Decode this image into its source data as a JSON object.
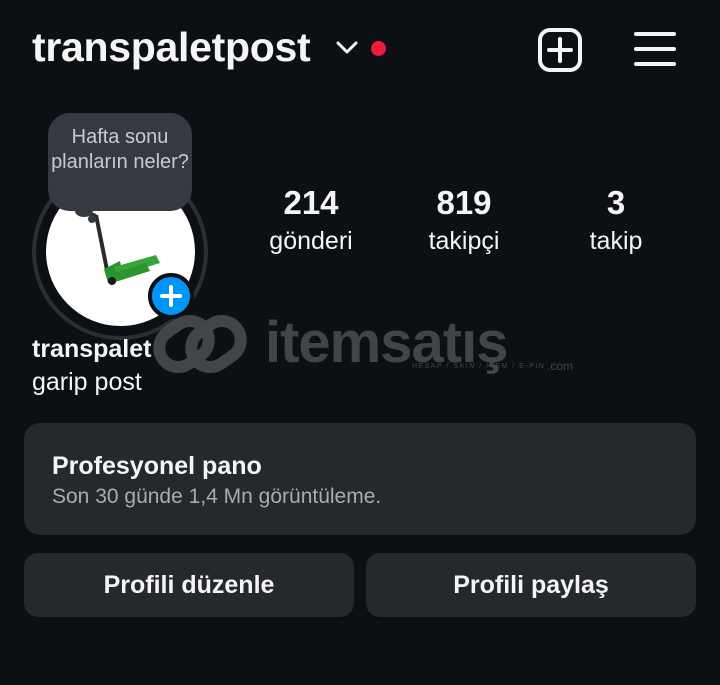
{
  "header": {
    "username": "transpaletpost",
    "icons": {
      "account_switch": "chevron-down-icon",
      "notification": "red-dot",
      "new_post": "plus-square-icon",
      "menu": "hamburger-menu-icon"
    },
    "notification_color": "#ed1c3a"
  },
  "note": {
    "text": "Hafta sonu planların neler?"
  },
  "stats": [
    {
      "value": "214",
      "label": "gönderi"
    },
    {
      "value": "819",
      "label": "takipçi"
    },
    {
      "value": "3",
      "label": "takip"
    }
  ],
  "profile": {
    "display_name": "transpalet",
    "bio": "garip post"
  },
  "watermark": {
    "text": "itemsatış",
    "sub": "HESAP / SKIN / ITEM / E-PIN",
    "suffix": ".com"
  },
  "dashboard": {
    "title": "Profesyonel pano",
    "subtitle": "Son 30 günde 1,4 Mn görüntüleme."
  },
  "buttons": {
    "edit_profile": "Profili düzenle",
    "share_profile": "Profili paylaş"
  },
  "colors": {
    "background": "#0c1014",
    "card": "#25292e",
    "accent": "#0095f6"
  }
}
